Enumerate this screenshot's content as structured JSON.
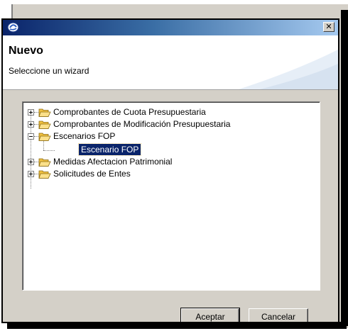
{
  "dialog": {
    "title_bar": {
      "app_icon": "eclipse-icon",
      "close_glyph": "✕",
      "close_icon": "close-icon"
    },
    "header": {
      "title": "Nuevo",
      "subtitle": "Seleccione un wizard"
    },
    "tree": {
      "items": [
        {
          "label": "Comprobantes de Cuota Presupuestaria",
          "expanded": false,
          "icon": "folder-icon"
        },
        {
          "label": "Comprobantes de Modificación Presupuestaria",
          "expanded": false,
          "icon": "folder-icon"
        },
        {
          "label": "Escenarios FOP",
          "expanded": true,
          "icon": "folder-icon",
          "children": [
            {
              "label": "Escenario FOP",
              "selected": true
            }
          ]
        },
        {
          "label": "Medidas Afectacion Patrimonial",
          "expanded": false,
          "icon": "folder-icon"
        },
        {
          "label": "Solicitudes de Entes",
          "expanded": false,
          "icon": "folder-icon"
        }
      ]
    },
    "buttons": {
      "accept": "Aceptar",
      "cancel": "Cancelar"
    }
  },
  "colors": {
    "selection": "#0a246a",
    "folder": "#f0c040",
    "titlebar_start": "#0a246a",
    "titlebar_end": "#a6caf0"
  }
}
